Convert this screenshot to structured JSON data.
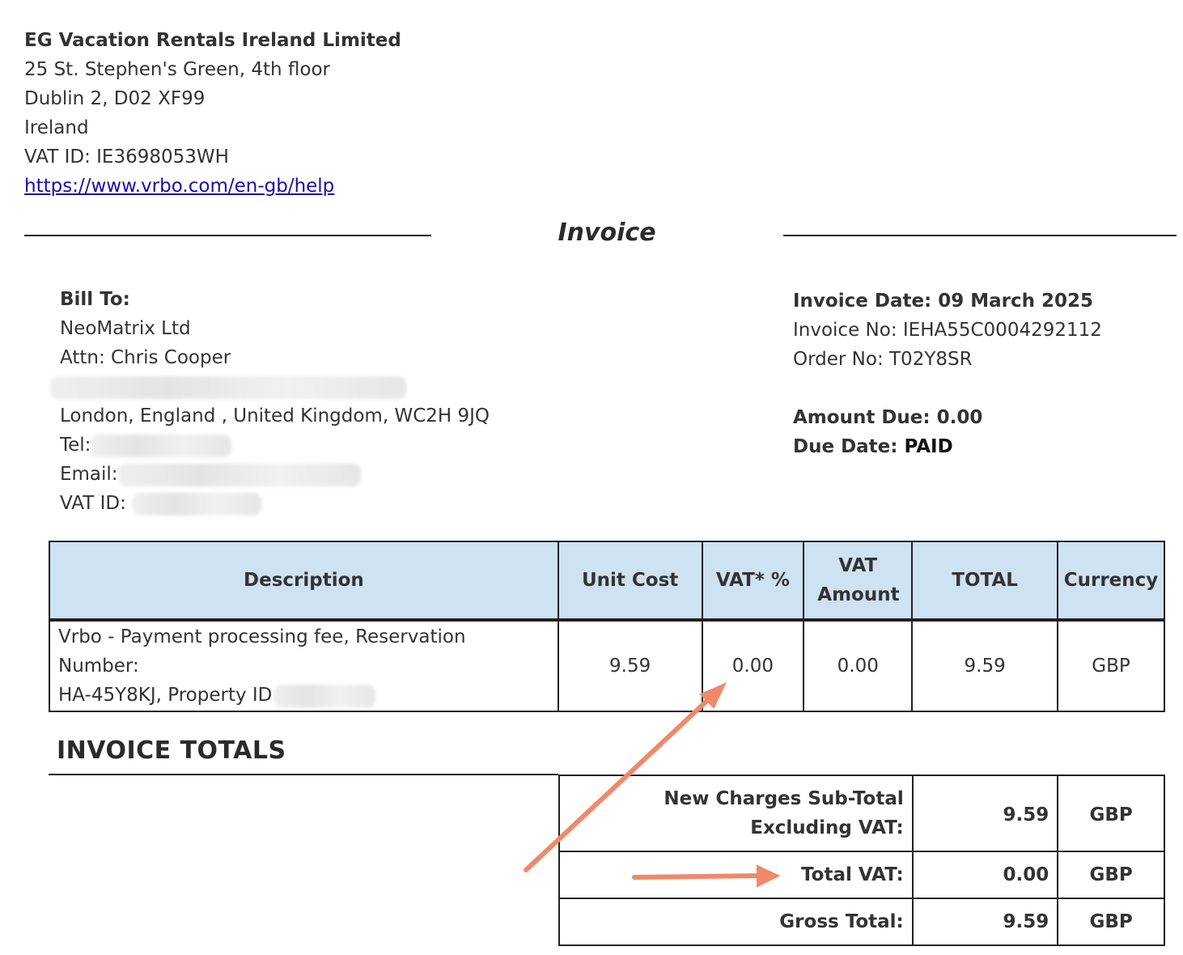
{
  "company": {
    "name": "EG Vacation Rentals Ireland Limited",
    "address_line1": "25 St. Stephen's Green, 4th floor",
    "address_line2": "Dublin 2, D02 XF99",
    "country": "Ireland",
    "vat_id": "VAT ID: IE3698053WH",
    "help_url": "https://www.vrbo.com/en-gb/help"
  },
  "doc_title": "Invoice",
  "bill_to": {
    "label": "Bill To:",
    "company": "NeoMatrix Ltd",
    "attn": "Attn: Chris Cooper",
    "city_line": "London, England , United Kingdom, WC2H 9JQ",
    "tel_label": "Tel:",
    "email_label": "Email:",
    "vat_label": "VAT ID:"
  },
  "invoice_meta": {
    "date": "Invoice Date: 09 March 2025",
    "number": "Invoice No: IEHA55C0004292112",
    "order": "Order No: T02Y8SR",
    "amount_due": "Amount Due: 0.00",
    "due_date_label": "Due Date: ",
    "due_date_value": "PAID"
  },
  "items_table": {
    "headers": [
      "Description",
      "Unit Cost",
      "VAT* %",
      "VAT Amount",
      "TOTAL",
      "Currency"
    ],
    "rows": [
      {
        "description_line1": "Vrbo - Payment processing fee, Reservation Number:",
        "description_line2": "HA-45Y8KJ, Property ID",
        "unit_cost": "9.59",
        "vat_pct": "0.00",
        "vat_amount": "0.00",
        "total": "9.59",
        "currency": "GBP"
      }
    ]
  },
  "totals": {
    "title": "INVOICE TOTALS",
    "rows": [
      {
        "label_line1": "New Charges Sub-Total",
        "label_line2": "Excluding VAT:",
        "amount": "9.59",
        "currency": "GBP"
      },
      {
        "label": "Total VAT:",
        "amount": "0.00",
        "currency": "GBP"
      },
      {
        "label": "Gross Total:",
        "amount": "9.59",
        "currency": "GBP"
      }
    ]
  },
  "annotation_color": "#f0896a"
}
